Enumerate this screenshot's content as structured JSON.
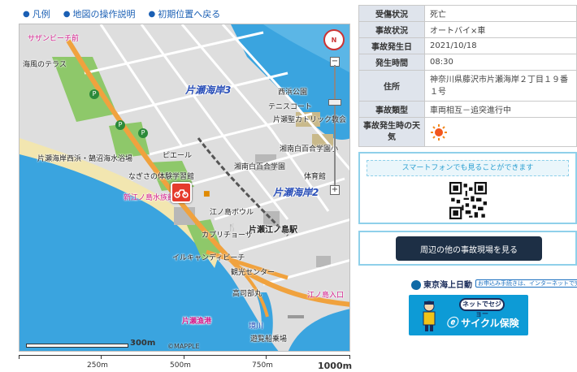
{
  "links": [
    {
      "label": "凡例"
    },
    {
      "label": "地図の操作説明"
    },
    {
      "label": "初期位置へ戻る"
    }
  ],
  "map": {
    "labels": {
      "shop": "サザンビーチ前",
      "terrace": "海風のテラス",
      "area3": "片瀬海岸3",
      "nishihama": "西浜公園",
      "tennis": "テニスコート",
      "church": "片瀬聖カトリック教会",
      "school": "湘南白百合学園小",
      "school2": "湘南白百合学園",
      "gym": "体育館",
      "area2": "片瀬海岸2",
      "seashore": "片瀬海岸西浜・鵠沼海水浴場",
      "pier": "ピエール",
      "fitness": "なぎさの体験学習館",
      "shinenoshima": "新江ノ島水族館",
      "bowl": "江ノ島ボウル",
      "capri": "カプリチョーザ",
      "station": "片瀬江ノ島駅",
      "illucandy": "イルキャンディビーチ",
      "kanko": "観光センター",
      "takada": "高司部丸",
      "enoshima_gate": "江ノ島入口",
      "katasekawa": "片瀬漁港",
      "river": "境川",
      "station2": "遊覧船乗場"
    },
    "scale_label": "300m",
    "copyright": "©MAPPLE",
    "compass_label": "N"
  },
  "bottom_scale": {
    "ticks": [
      "250m",
      "500m",
      "750m",
      "1000m"
    ]
  },
  "info": {
    "rows": [
      {
        "key": "受傷状況",
        "value": "死亡"
      },
      {
        "key": "事故状況",
        "value": "オートバイ×車"
      },
      {
        "key": "事故発生日",
        "value": "2021/10/18"
      },
      {
        "key": "発生時間",
        "value": "08:30"
      },
      {
        "key": "住所",
        "value": "神奈川県藤沢市片瀬海岸２丁目１９番１号"
      },
      {
        "key": "事故類型",
        "value": "車両相互－追突進行中"
      },
      {
        "key": "事故発生時の天気",
        "value": "",
        "icon": "sun-icon"
      }
    ]
  },
  "smartphone": {
    "header": "スマートフォンでも見ることができます"
  },
  "nearby": {
    "button_label": "周辺の他の事故現場を見る"
  },
  "ad": {
    "brand": "東京海上日動",
    "note": "お申込み手続きは、インターネットで完結！",
    "bubble": "ネットでセジョー",
    "title": "サイクル保険"
  },
  "colors": {
    "link": "#1a5fb4",
    "sea": "#3aa4df",
    "park": "#8ec86a",
    "road_main": "#f0a23e",
    "table_key_bg": "#dfe4ec",
    "box_border": "#8fd0ea",
    "button_bg": "#1d2f45",
    "accident_marker": "#e53b2c",
    "ad_bg": "#0d9bd6"
  }
}
